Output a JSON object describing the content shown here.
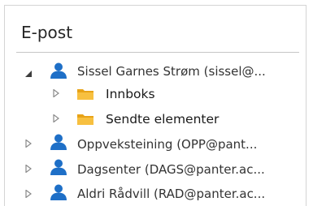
{
  "pane": {
    "title": "E-post"
  },
  "tree": {
    "accounts": [
      {
        "label": "Sissel Garnes Strøm (sissel@...",
        "expanded": true,
        "icon": "person-icon",
        "folders": [
          {
            "label": "Innboks",
            "icon": "folder-icon",
            "expanded": false
          },
          {
            "label": "Sendte elementer",
            "icon": "folder-icon",
            "expanded": false
          }
        ]
      },
      {
        "label": "Oppveksteining (OPP@pant...",
        "expanded": false,
        "icon": "person-icon"
      },
      {
        "label": "Dagsenter (DAGS@panter.ac...",
        "expanded": false,
        "icon": "person-icon"
      },
      {
        "label": "Aldri Rådvill (RAD@panter.ac...",
        "expanded": false,
        "icon": "person-icon"
      }
    ]
  },
  "colors": {
    "person_icon": "#1e6fc7",
    "folder_icon": "#f2b21e",
    "arrow_collapsed": "#8a8a8a",
    "arrow_expanded": "#3d3d3d"
  }
}
